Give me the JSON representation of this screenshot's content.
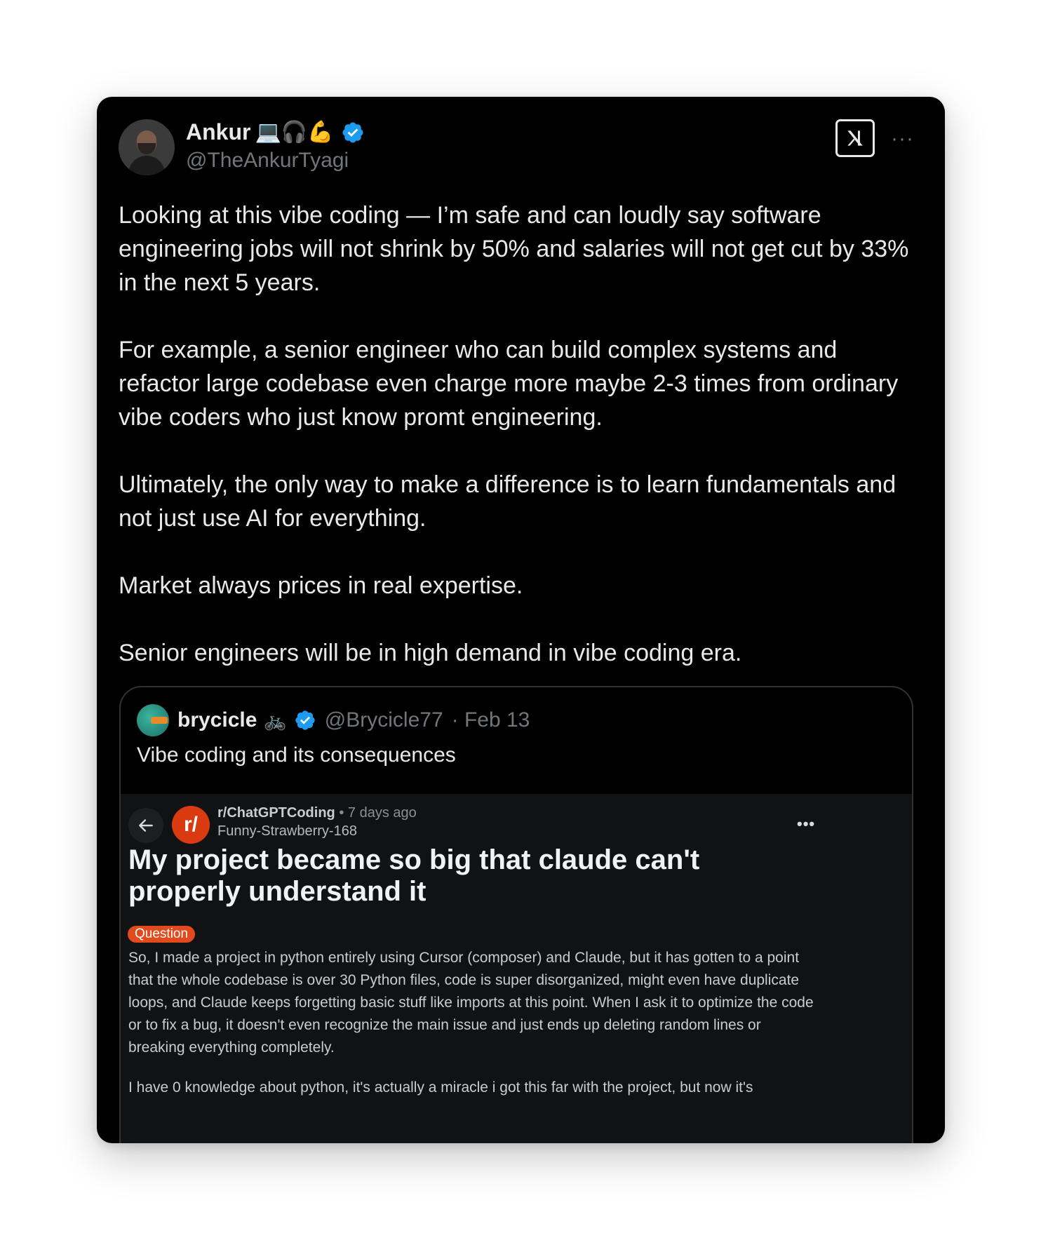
{
  "tweet": {
    "author_name": "Ankur",
    "author_emojis": "💻🎧💪",
    "handle": "@TheAnkurTyagi",
    "paragraphs": [
      "Looking at this vibe coding — I’m safe and can loudly say software engineering jobs will not shrink by 50% and salaries will not get cut by 33% in the next 5 years.",
      "For example, a senior engineer who can build complex systems and refactor large codebase even charge more maybe 2-3 times from ordinary vibe coders who just know promt engineering.",
      "Ultimately, the only way to make a difference is to learn fundamentals and not just use AI for everything.",
      "Market always prices in real expertise.",
      "Senior engineers will be in high demand in vibe coding era."
    ],
    "more_label": "···"
  },
  "quote": {
    "author_name": "brycicle",
    "author_emoji": "🚲",
    "handle": "@Brycicle77",
    "date": "· Feb 13",
    "text": "Vibe coding and its consequences"
  },
  "reddit": {
    "subreddit": "r/ChatGPTCoding",
    "time": "• 7 days ago",
    "user": "Funny-Strawberry-168",
    "icon_text": "r/",
    "more_label": "•••",
    "title": "My project became so big that claude can't properly understand it",
    "flair": "Question",
    "body": [
      "So, I made a project in python entirely using Cursor (composer) and Claude, but it has gotten to a point that the whole codebase is over 30 Python files, code is super disorganized, might even have duplicate loops, and Claude keeps forgetting basic stuff like imports at this point. When I ask it to optimize the code or to fix a bug, it doesn't even recognize the main issue and just ends up deleting random lines or breaking everything completely.",
      "I have 0 knowledge about python, it's actually a miracle i got this far with the project, but now it's"
    ]
  },
  "icons": {
    "verified": "verified-badge-icon",
    "x_logo": "x-logo-icon",
    "back": "back-arrow-icon"
  },
  "colors": {
    "card_bg": "#000000",
    "text": "#e7e9ea",
    "secondary_text": "#71767b",
    "verified_blue": "#1d9bf0",
    "reddit_orange": "#d93a0f",
    "flair": "#e14a1c"
  }
}
